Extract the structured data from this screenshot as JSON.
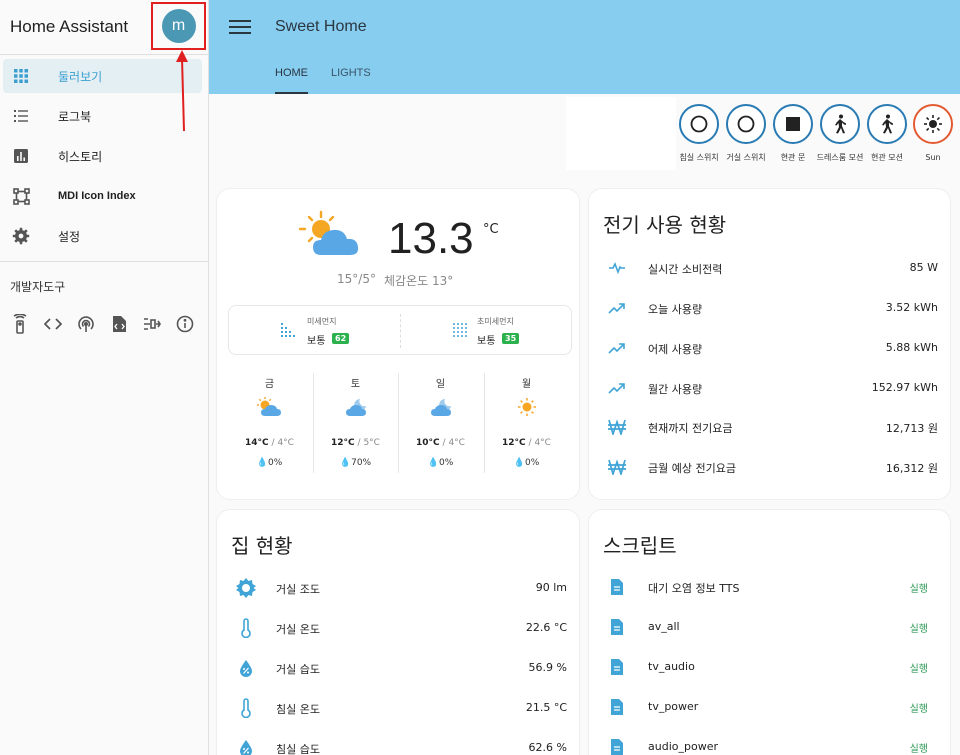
{
  "app": {
    "title": "Home Assistant",
    "avatar_letter": "m"
  },
  "sidebar": {
    "items": [
      {
        "label": "둘러보기",
        "icon": "grid-icon",
        "active": true
      },
      {
        "label": "로그북",
        "icon": "list-icon"
      },
      {
        "label": "히스토리",
        "icon": "chart-icon"
      },
      {
        "label": "MDI Icon Index",
        "icon": "vector-square-icon"
      },
      {
        "label": "설정",
        "icon": "gear-icon"
      }
    ],
    "dev_tools_label": "개발자도구",
    "dev_tools_icons": [
      "remote-icon",
      "code-icon",
      "antenna-icon",
      "file-code-icon",
      "state-icon",
      "info-icon"
    ]
  },
  "header": {
    "title": "Sweet Home",
    "tabs": [
      "HOME",
      "LIGHTS"
    ]
  },
  "entities": [
    {
      "label": "침실 스위치",
      "icon": "circle-outline-icon"
    },
    {
      "label": "거실 스위치",
      "icon": "circle-outline-icon"
    },
    {
      "label": "현관 문",
      "icon": "square-icon"
    },
    {
      "label": "드레스룸 모션",
      "icon": "walk-icon"
    },
    {
      "label": "현관 모션",
      "icon": "walk-icon"
    },
    {
      "label": "Sun",
      "icon": "sun-icon"
    }
  ],
  "weather": {
    "temp": "13.3",
    "unit": "°C",
    "hilo": "15°/5°",
    "feels": "체감온도 13°",
    "pm10": {
      "label": "미세먼지",
      "status": "보통",
      "value": "62"
    },
    "pm25": {
      "label": "초미세먼지",
      "status": "보통",
      "value": "35"
    },
    "forecast": [
      {
        "day": "금",
        "icon": "partly-sunny-icon",
        "high": "14°C",
        "low": "/ 4°C",
        "precip": "0%"
      },
      {
        "day": "토",
        "icon": "partly-cloudy-night-icon",
        "high": "12°C",
        "low": "/ 5°C",
        "precip": "70%"
      },
      {
        "day": "일",
        "icon": "partly-cloudy-night-icon",
        "high": "10°C",
        "low": "/ 4°C",
        "precip": "0%"
      },
      {
        "day": "월",
        "icon": "sunny-icon",
        "high": "12°C",
        "low": "/ 4°C",
        "precip": "0%"
      }
    ]
  },
  "energy": {
    "title": "전기 사용 현황",
    "rows": [
      {
        "icon": "pulse-icon",
        "name": "실시간 소비전력",
        "value": "85 W"
      },
      {
        "icon": "trending-up-icon",
        "name": "오늘 사용량",
        "value": "3.52 kWh"
      },
      {
        "icon": "trending-up-icon",
        "name": "어제 사용량",
        "value": "5.88 kWh"
      },
      {
        "icon": "trending-up-icon",
        "name": "월간 사용량",
        "value": "152.97 kWh"
      },
      {
        "icon": "won-icon",
        "name": "현재까지 전기요금",
        "value": "12,713 원"
      },
      {
        "icon": "won-icon",
        "name": "금월 예상 전기요금",
        "value": "16,312 원"
      }
    ]
  },
  "house": {
    "title": "집 현황",
    "rows": [
      {
        "icon": "brightness-icon",
        "name": "거실 조도",
        "value": "90 lm"
      },
      {
        "icon": "thermometer-icon",
        "name": "거실 온도",
        "value": "22.6 °C"
      },
      {
        "icon": "water-percent-icon",
        "name": "거실 습도",
        "value": "56.9 %"
      },
      {
        "icon": "thermometer-icon",
        "name": "침실 온도",
        "value": "21.5 °C"
      },
      {
        "icon": "water-percent-icon",
        "name": "침실 습도",
        "value": "62.6 %"
      }
    ]
  },
  "scripts": {
    "title": "스크립트",
    "rows": [
      {
        "icon": "file-document-icon",
        "name": "대기 오염 정보 TTS",
        "action": "실행"
      },
      {
        "icon": "file-document-icon",
        "name": "av_all",
        "action": "실행"
      },
      {
        "icon": "file-document-icon",
        "name": "tv_audio",
        "action": "실행"
      },
      {
        "icon": "file-document-icon",
        "name": "tv_power",
        "action": "실행"
      },
      {
        "icon": "file-document-icon",
        "name": "audio_power",
        "action": "실행"
      }
    ]
  },
  "colors": {
    "accent": "#3d9fd0",
    "header_bg": "#87cdf0",
    "icon_blue": "#40a4d6",
    "action_green": "#2e9a57",
    "badge_green": "#2bb24c",
    "annotation_red": "#e02020"
  }
}
